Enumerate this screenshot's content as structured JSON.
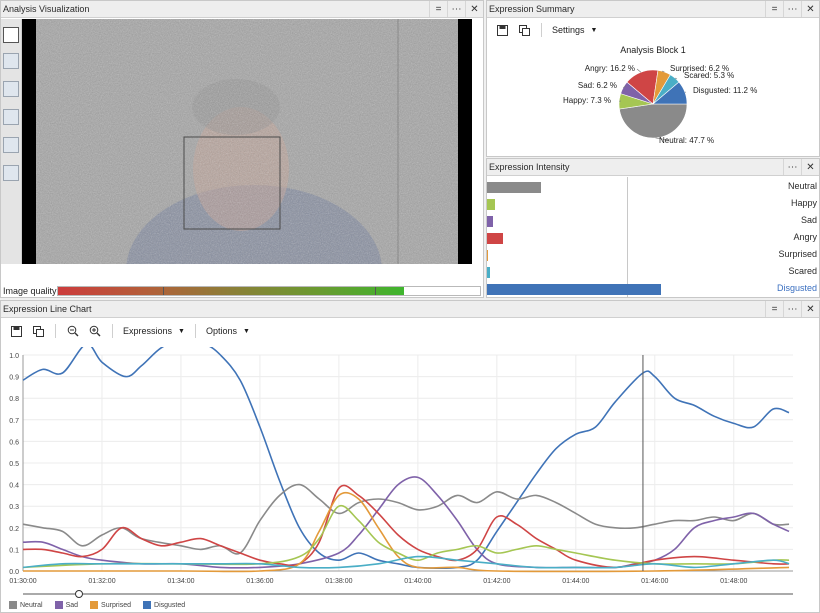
{
  "analysis": {
    "title": "Analysis Visualization",
    "quality_label": "Image quality",
    "quality_fraction": 0.82
  },
  "summary": {
    "title": "Expression Summary",
    "settings_label": "Settings",
    "block_title": "Analysis Block 1"
  },
  "intensity": {
    "title": "Expression Intensity",
    "rows": [
      {
        "label": "Neutral",
        "value": 0.35,
        "color": "#8a8a8a",
        "selected": false
      },
      {
        "label": "Happy",
        "value": 0.05,
        "color": "#a5c653",
        "selected": false
      },
      {
        "label": "Sad",
        "value": 0.04,
        "color": "#7f62a9",
        "selected": false
      },
      {
        "label": "Angry",
        "value": 0.1,
        "color": "#cf4545",
        "selected": false
      },
      {
        "label": "Surprised",
        "value": 0.0,
        "color": "#e39a3a",
        "selected": false
      },
      {
        "label": "Scared",
        "value": 0.02,
        "color": "#4aaec6",
        "selected": false
      },
      {
        "label": "Disgusted",
        "value": 1.12,
        "color": "#3f73b7",
        "selected": true
      }
    ]
  },
  "linechart": {
    "title": "Expression Line Chart",
    "expressions_label": "Expressions",
    "options_label": "Options"
  },
  "colors": {
    "Neutral": "#8a8a8a",
    "Happy": "#a5c653",
    "Sad": "#7f62a9",
    "Angry": "#cf4545",
    "Surprised": "#e39a3a",
    "Scared": "#4aaec6",
    "Disgusted": "#3f73b7"
  },
  "chart_data": [
    {
      "type": "pie",
      "title": "Analysis Block 1",
      "slices": [
        {
          "name": "Neutral",
          "value": 47.7,
          "label": "Neutral: 47.7 %"
        },
        {
          "name": "Happy",
          "value": 7.3,
          "label": "Happy: 7.3 %"
        },
        {
          "name": "Sad",
          "value": 6.2,
          "label": "Sad: 6.2 %"
        },
        {
          "name": "Angry",
          "value": 16.2,
          "label": "Angry: 16.2 %"
        },
        {
          "name": "Surprised",
          "value": 6.2,
          "label": "Surprised: 6.2 %"
        },
        {
          "name": "Scared",
          "value": 5.3,
          "label": "Scared: 5.3 %"
        },
        {
          "name": "Disgusted",
          "value": 11.2,
          "label": "Disgusted: 11.2 %"
        }
      ]
    },
    {
      "type": "line",
      "x_ticks": [
        "01:30:00",
        "01:32:00",
        "01:34:00",
        "01:36:00",
        "01:38:00",
        "01:40:00",
        "01:42:00",
        "01:44:00",
        "01:46:00",
        "01:48:00"
      ],
      "x_tick_minutes": [
        90,
        92,
        94,
        96,
        98,
        100,
        102,
        104,
        106,
        108
      ],
      "xlim": [
        90,
        109.5
      ],
      "y_ticks": [
        "0.0",
        "0.1",
        "0.2",
        "0.3",
        "0.4",
        "0.5",
        "0.6",
        "0.7",
        "0.8",
        "0.9",
        "1.0"
      ],
      "ylim": [
        0,
        0.6
      ],
      "grid": true,
      "cursor_minutes": 105.7,
      "legend": [
        "Neutral",
        "Sad",
        "Surprised",
        "Disgusted"
      ],
      "series": [
        {
          "name": "Disgusted",
          "points": [
            [
              90,
              0.53
            ],
            [
              90.5,
              0.56
            ],
            [
              91,
              0.55
            ],
            [
              91.6,
              0.63
            ],
            [
              92,
              0.58
            ],
            [
              92.6,
              0.54
            ],
            [
              93,
              0.57
            ],
            [
              93.5,
              0.62
            ],
            [
              94,
              0.64
            ],
            [
              94.6,
              0.63
            ],
            [
              95,
              0.6
            ],
            [
              95.5,
              0.53
            ],
            [
              96,
              0.4
            ],
            [
              96.5,
              0.25
            ],
            [
              97,
              0.12
            ],
            [
              97.5,
              0.05
            ],
            [
              98,
              0.03
            ],
            [
              98.5,
              0.05
            ],
            [
              99,
              0.03
            ],
            [
              99.5,
              0.02
            ],
            [
              100,
              0.01
            ],
            [
              101,
              0.01
            ],
            [
              101.5,
              0.03
            ],
            [
              102,
              0.11
            ],
            [
              102.5,
              0.19
            ],
            [
              103,
              0.27
            ],
            [
              103.5,
              0.34
            ],
            [
              104,
              0.38
            ],
            [
              104.5,
              0.4
            ],
            [
              105,
              0.47
            ],
            [
              105.7,
              0.55
            ],
            [
              106,
              0.54
            ],
            [
              106.5,
              0.48
            ],
            [
              107,
              0.46
            ],
            [
              107.5,
              0.43
            ],
            [
              108,
              0.41
            ],
            [
              108.5,
              0.4
            ],
            [
              109,
              0.45
            ],
            [
              109.4,
              0.44
            ]
          ]
        },
        {
          "name": "Neutral",
          "points": [
            [
              90,
              0.13
            ],
            [
              90.5,
              0.12
            ],
            [
              91,
              0.11
            ],
            [
              91.5,
              0.07
            ],
            [
              92,
              0.1
            ],
            [
              92.5,
              0.12
            ],
            [
              93,
              0.09
            ],
            [
              94,
              0.07
            ],
            [
              94.5,
              0.06
            ],
            [
              95,
              0.07
            ],
            [
              95.5,
              0.05
            ],
            [
              96,
              0.14
            ],
            [
              96.5,
              0.21
            ],
            [
              97,
              0.24
            ],
            [
              97.5,
              0.2
            ],
            [
              98,
              0.16
            ],
            [
              98.5,
              0.19
            ],
            [
              99,
              0.2
            ],
            [
              99.5,
              0.19
            ],
            [
              100,
              0.17
            ],
            [
              100.5,
              0.18
            ],
            [
              101,
              0.21
            ],
            [
              101.5,
              0.19
            ],
            [
              102,
              0.22
            ],
            [
              102.5,
              0.2
            ],
            [
              103,
              0.21
            ],
            [
              103.5,
              0.19
            ],
            [
              104,
              0.16
            ],
            [
              104.5,
              0.13
            ],
            [
              105,
              0.12
            ],
            [
              105.5,
              0.12
            ],
            [
              106,
              0.13
            ],
            [
              106.5,
              0.14
            ],
            [
              107,
              0.14
            ],
            [
              107.5,
              0.15
            ],
            [
              108,
              0.14
            ],
            [
              108.5,
              0.16
            ],
            [
              109,
              0.13
            ],
            [
              109.4,
              0.13
            ]
          ]
        },
        {
          "name": "Sad",
          "points": [
            [
              90,
              0.08
            ],
            [
              90.5,
              0.08
            ],
            [
              91,
              0.06
            ],
            [
              91.5,
              0.04
            ],
            [
              92,
              0.03
            ],
            [
              93,
              0.02
            ],
            [
              94,
              0.02
            ],
            [
              95,
              0.01
            ],
            [
              96,
              0.01
            ],
            [
              97,
              0.02
            ],
            [
              98,
              0.05
            ],
            [
              98.5,
              0.1
            ],
            [
              99,
              0.17
            ],
            [
              99.5,
              0.24
            ],
            [
              100,
              0.26
            ],
            [
              100.5,
              0.21
            ],
            [
              101,
              0.14
            ],
            [
              101.5,
              0.06
            ],
            [
              102,
              0.02
            ],
            [
              103,
              0.01
            ],
            [
              104,
              0.01
            ],
            [
              105,
              0.01
            ],
            [
              105.5,
              0.02
            ],
            [
              106,
              0.03
            ],
            [
              106.5,
              0.06
            ],
            [
              107,
              0.12
            ],
            [
              107.5,
              0.14
            ],
            [
              108,
              0.15
            ],
            [
              108.5,
              0.16
            ],
            [
              109,
              0.13
            ],
            [
              109.4,
              0.11
            ]
          ]
        },
        {
          "name": "Angry",
          "points": [
            [
              90,
              0.06
            ],
            [
              90.5,
              0.06
            ],
            [
              91,
              0.05
            ],
            [
              91.5,
              0.04
            ],
            [
              92,
              0.06
            ],
            [
              92.5,
              0.12
            ],
            [
              93,
              0.09
            ],
            [
              93.5,
              0.07
            ],
            [
              94,
              0.08
            ],
            [
              94.5,
              0.09
            ],
            [
              95,
              0.07
            ],
            [
              95.5,
              0.05
            ],
            [
              96,
              0.03
            ],
            [
              96.5,
              0.02
            ],
            [
              97,
              0.02
            ],
            [
              97.5,
              0.08
            ],
            [
              98,
              0.23
            ],
            [
              98.5,
              0.21
            ],
            [
              99,
              0.16
            ],
            [
              99.5,
              0.1
            ],
            [
              100,
              0.06
            ],
            [
              100.5,
              0.04
            ],
            [
              101,
              0.03
            ],
            [
              101.5,
              0.06
            ],
            [
              102,
              0.15
            ],
            [
              102.5,
              0.13
            ],
            [
              103,
              0.09
            ],
            [
              103.5,
              0.06
            ],
            [
              104,
              0.03
            ],
            [
              105,
              0.01
            ],
            [
              106,
              0.03
            ],
            [
              107,
              0.04
            ],
            [
              108,
              0.03
            ],
            [
              109,
              0.02
            ],
            [
              109.4,
              0.02
            ]
          ]
        },
        {
          "name": "Surprised",
          "points": [
            [
              90,
              0.0
            ],
            [
              94,
              0.0
            ],
            [
              96,
              0.0
            ],
            [
              97,
              0.02
            ],
            [
              97.5,
              0.11
            ],
            [
              98,
              0.21
            ],
            [
              98.5,
              0.2
            ],
            [
              99,
              0.12
            ],
            [
              99.5,
              0.04
            ],
            [
              100,
              0.01
            ],
            [
              101,
              0.01
            ],
            [
              102,
              0.0
            ],
            [
              106,
              0.0
            ],
            [
              109.4,
              0.01
            ]
          ]
        },
        {
          "name": "Happy",
          "points": [
            [
              90,
              0.01
            ],
            [
              92,
              0.02
            ],
            [
              94,
              0.02
            ],
            [
              96,
              0.02
            ],
            [
              97,
              0.04
            ],
            [
              97.5,
              0.09
            ],
            [
              98,
              0.18
            ],
            [
              98.5,
              0.14
            ],
            [
              99,
              0.08
            ],
            [
              99.5,
              0.05
            ],
            [
              100,
              0.03
            ],
            [
              100.5,
              0.05
            ],
            [
              101,
              0.06
            ],
            [
              101.5,
              0.07
            ],
            [
              102,
              0.05
            ],
            [
              102.5,
              0.06
            ],
            [
              103,
              0.07
            ],
            [
              103.5,
              0.06
            ],
            [
              104,
              0.05
            ],
            [
              105,
              0.03
            ],
            [
              106,
              0.02
            ],
            [
              107,
              0.02
            ],
            [
              108,
              0.02
            ],
            [
              109,
              0.03
            ],
            [
              109.4,
              0.03
            ]
          ]
        },
        {
          "name": "Scared",
          "points": [
            [
              90,
              0.01
            ],
            [
              91,
              0.02
            ],
            [
              92,
              0.02
            ],
            [
              94,
              0.02
            ],
            [
              95,
              0.02
            ],
            [
              96,
              0.02
            ],
            [
              97,
              0.01
            ],
            [
              98,
              0.01
            ],
            [
              99,
              0.02
            ],
            [
              100,
              0.04
            ],
            [
              101,
              0.03
            ],
            [
              102,
              0.02
            ],
            [
              103,
              0.01
            ],
            [
              104,
              0.01
            ],
            [
              105,
              0.01
            ],
            [
              106,
              0.02
            ],
            [
              107,
              0.01
            ],
            [
              108,
              0.02
            ],
            [
              109,
              0.03
            ],
            [
              109.4,
              0.02
            ]
          ]
        }
      ]
    }
  ]
}
